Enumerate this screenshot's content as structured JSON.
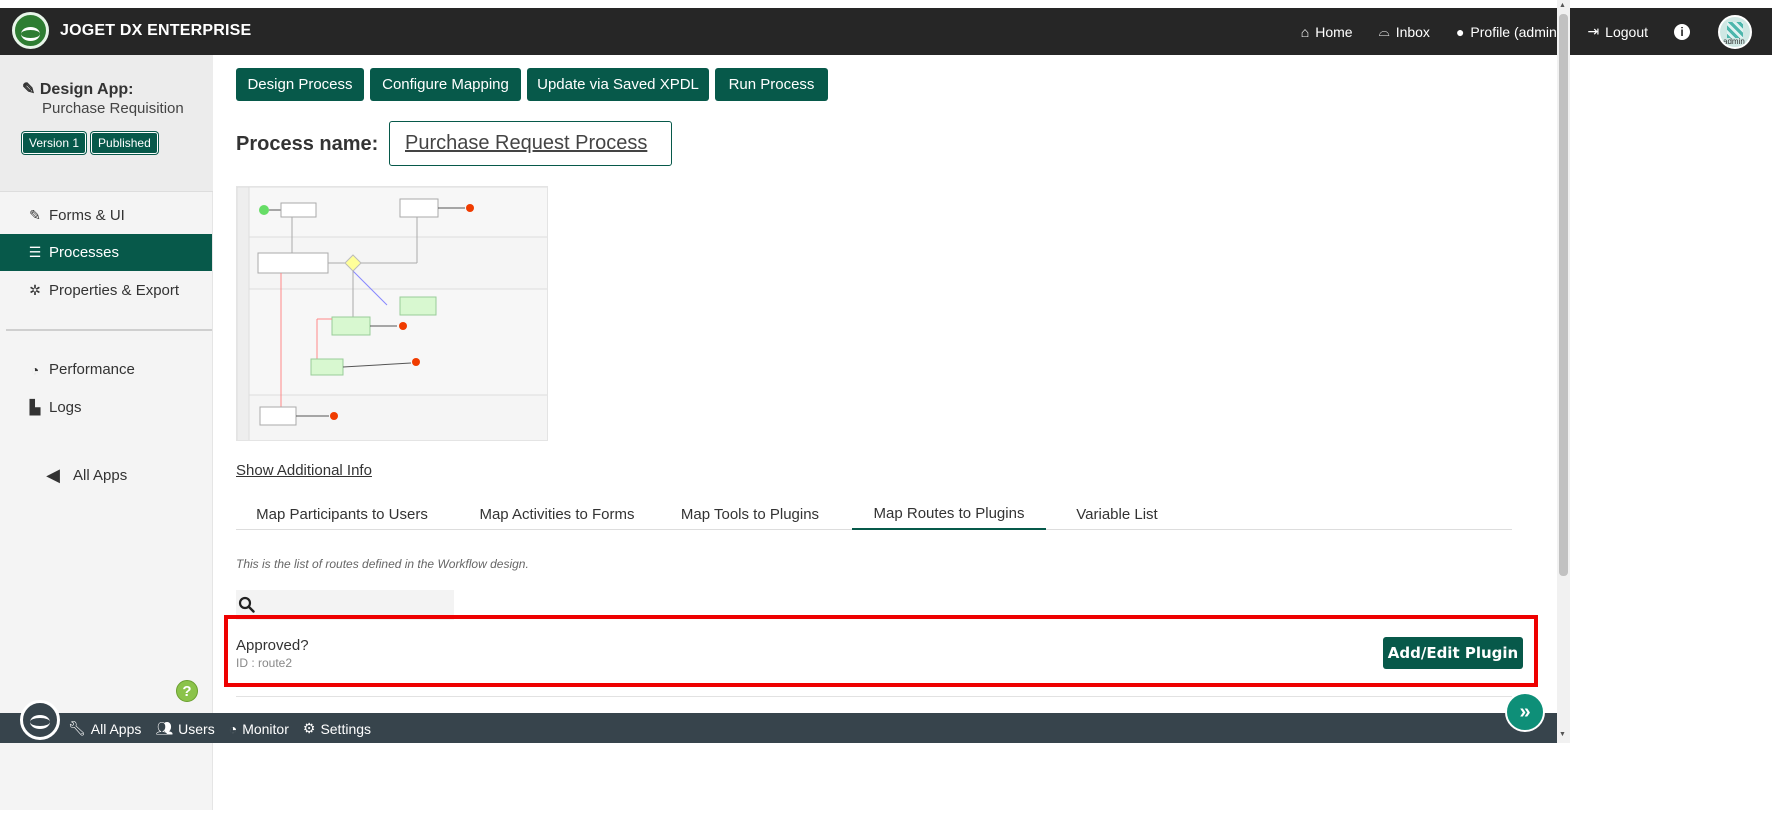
{
  "brand": "JOGET DX ENTERPRISE",
  "topnav": {
    "home": "Home",
    "inbox": "Inbox",
    "profile": "Profile (admin)",
    "logout": "Logout",
    "avatar_text": "admin"
  },
  "sidebar": {
    "design_app_label": "Design App:",
    "app_name": "Purchase Requisition",
    "version_badge": "Version 1",
    "published_badge": "Published",
    "items": [
      "Forms & UI",
      "Processes",
      "Properties & Export",
      "Performance",
      "Logs"
    ],
    "all_apps": "All Apps"
  },
  "actions": [
    "Design Process",
    "Configure Mapping",
    "Update via Saved XPDL",
    "Run Process"
  ],
  "process": {
    "label": "Process name:",
    "name": "Purchase Request Process"
  },
  "show_info": "Show Additional Info",
  "tabs": [
    "Map Participants to Users",
    "Map Activities to Forms",
    "Map Tools to Plugins",
    "Map Routes to Plugins",
    "Variable List"
  ],
  "active_tab": "Map Routes to Plugins",
  "description": "This is the list of routes defined in the Workflow design.",
  "route": {
    "name": "Approved?",
    "id": "ID : route2",
    "button": "Add/Edit Plugin"
  },
  "bottombar": [
    "All Apps",
    "Users",
    "Monitor",
    "Settings"
  ],
  "colors": {
    "primary": "#07594a",
    "topbar": "#262626",
    "bottombar": "#37444c",
    "highlight": "#ee0000"
  }
}
